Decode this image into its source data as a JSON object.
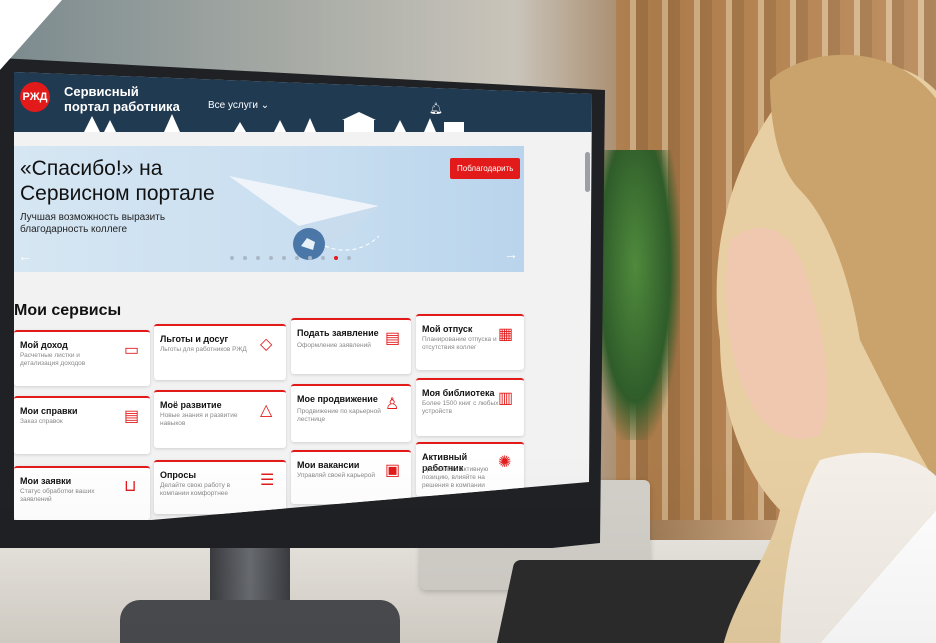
{
  "header": {
    "logo_text": "РЖД",
    "brand_line1": "Сервисный",
    "brand_line2": "портал работника",
    "nav_all_services": "Все услуги ⌄"
  },
  "banner": {
    "title_line1": "«Спасибо!» на",
    "title_line2": "Сервисном портале",
    "subtitle": "Лучшая возможность выразить благодарность коллеге",
    "button_label": "Поблагодарить",
    "slide_count": 10,
    "active_slide_index": 8
  },
  "services": {
    "section_title": "Мои сервисы",
    "cards": [
      {
        "title": "Мой доход",
        "desc": "Расчетные листки и детализация доходов",
        "icon": "wallet-icon"
      },
      {
        "title": "Льготы и досуг",
        "desc": "Льготы для работников РЖД",
        "icon": "tag-icon"
      },
      {
        "title": "Подать заявление",
        "desc": "Оформление заявлений",
        "icon": "document-icon"
      },
      {
        "title": "Мой отпуск",
        "desc": "Планирование отпуска и отсутствия коллег",
        "icon": "calendar-icon"
      },
      {
        "title": "Мои справки",
        "desc": "Заказ справок",
        "icon": "file-icon"
      },
      {
        "title": "Моё развитие",
        "desc": "Новые знания и развитие навыков",
        "icon": "graduation-cap-icon"
      },
      {
        "title": "Мое продвижение",
        "desc": "Продвижение по карьерной лестнице",
        "icon": "career-ladder-icon"
      },
      {
        "title": "Моя библиотека",
        "desc": "Более 1500 книг с любых устройств",
        "icon": "books-icon"
      },
      {
        "title": "Мои заявки",
        "desc": "Статус обработки ваших заявлений",
        "icon": "inbox-icon"
      },
      {
        "title": "Опросы",
        "desc": "Делайте свою работу в компании комфортнее",
        "icon": "checklist-icon"
      },
      {
        "title": "Мои вакансии",
        "desc": "Управляй своей карьерой",
        "icon": "briefcase-icon"
      },
      {
        "title": "Активный работник",
        "desc": "Проявляйте активную позицию, влияйте на решения в компании",
        "icon": "lightbulb-icon"
      }
    ]
  },
  "colors": {
    "accent": "#e21a1a",
    "header_bg": "#203a52"
  }
}
